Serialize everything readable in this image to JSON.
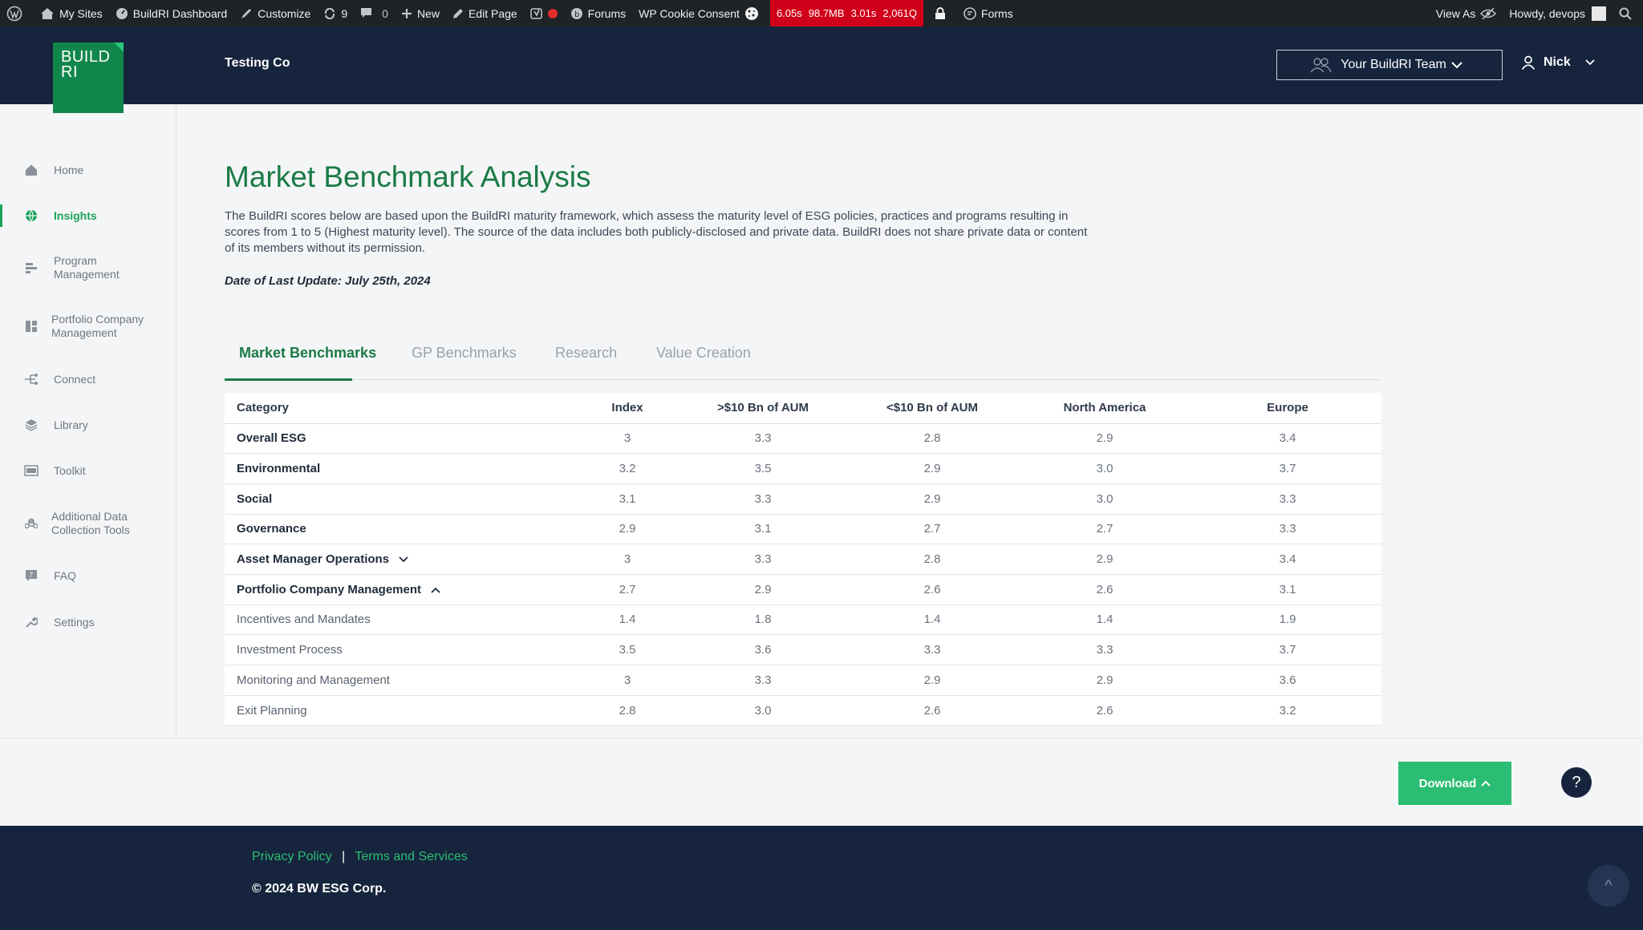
{
  "adminbar": {
    "my_sites": "My Sites",
    "dashboard": "BuildRI Dashboard",
    "customize": "Customize",
    "updates_count": "9",
    "comments_count": "0",
    "new": "New",
    "edit_page": "Edit Page",
    "forums": "Forums",
    "cookie_consent": "WP Cookie Consent",
    "perf": {
      "time": "6.05s",
      "memory": "98.7MB",
      "query_time": "3.01s",
      "queries": "2,061Q"
    },
    "forms": "Forms",
    "view_as": "View As",
    "howdy": "Howdy, devops"
  },
  "header": {
    "logo_line1": "BUILD",
    "logo_line2": "RI",
    "company": "Testing Co",
    "team_button": "Your BuildRI Team",
    "user_name": "Nick"
  },
  "sidebar": {
    "items": [
      {
        "label": "Home",
        "icon": "home-icon"
      },
      {
        "label": "Insights",
        "icon": "globe-icon"
      },
      {
        "label": "Program Management",
        "icon": "bars-icon"
      },
      {
        "label": "Portfolio Company Management",
        "icon": "grid-icon"
      },
      {
        "label": "Connect",
        "icon": "connect-icon"
      },
      {
        "label": "Library",
        "icon": "layers-icon"
      },
      {
        "label": "Toolkit",
        "icon": "toolkit-icon"
      },
      {
        "label": "Additional Data Collection Tools",
        "icon": "command-icon"
      },
      {
        "label": "FAQ",
        "icon": "faq-icon"
      },
      {
        "label": "Settings",
        "icon": "wrench-icon"
      }
    ]
  },
  "main": {
    "title": "Market Benchmark Analysis",
    "intro": "The BuildRI scores below are based upon the BuildRI maturity framework, which assess the maturity level of ESG policies, practices and programs resulting in scores from 1 to 5 (Highest maturity level). The source of the data includes both publicly-disclosed and private data. BuildRI does not share private data or content of its members without its permission.",
    "last_update": "Date of Last Update: July 25th, 2024",
    "tabs": [
      "Market Benchmarks",
      "GP Benchmarks",
      "Research",
      "Value Creation"
    ],
    "table": {
      "headers": [
        "Category",
        "Index",
        ">$10 Bn of AUM",
        "<$10 Bn of AUM",
        "North America",
        "Europe"
      ],
      "rows": [
        [
          "Overall ESG",
          "3",
          "3.3",
          "2.8",
          "2.9",
          "3.4"
        ],
        [
          "Environmental",
          "3.2",
          "3.5",
          "2.9",
          "3.0",
          "3.7"
        ],
        [
          "Social",
          "3.1",
          "3.3",
          "2.9",
          "3.0",
          "3.3"
        ],
        [
          "Governance",
          "2.9",
          "3.1",
          "2.7",
          "2.7",
          "3.3"
        ],
        [
          "Asset Manager Operations",
          "3",
          "3.3",
          "2.8",
          "2.9",
          "3.4"
        ],
        [
          "Portfolio Company Management",
          "2.7",
          "2.9",
          "2.6",
          "2.6",
          "3.1"
        ],
        [
          "Incentives and Mandates",
          "1.4",
          "1.8",
          "1.4",
          "1.4",
          "1.9"
        ],
        [
          "Investment Process",
          "3.5",
          "3.6",
          "3.3",
          "3.3",
          "3.7"
        ],
        [
          "Monitoring and Management",
          "3",
          "3.3",
          "2.9",
          "2.9",
          "3.6"
        ],
        [
          "Exit Planning",
          "2.8",
          "3.0",
          "2.6",
          "2.6",
          "3.2"
        ]
      ]
    },
    "download": "Download",
    "help": "?"
  },
  "footer": {
    "privacy": "Privacy Policy",
    "separator": "|",
    "terms": "Terms and Services",
    "copyright": "© 2024 BW ESG Corp.",
    "to_top": "^"
  },
  "colors": {
    "navy": "#16243d",
    "green": "#1a7a45",
    "accent": "#2bbd73",
    "admin_bar": "#1d2327"
  }
}
